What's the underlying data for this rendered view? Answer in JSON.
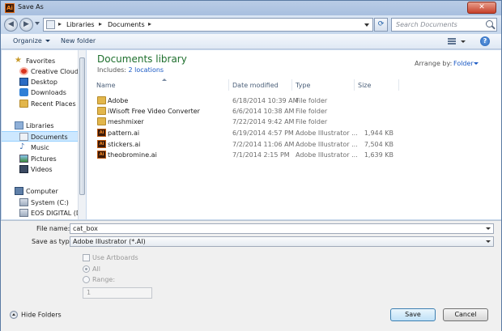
{
  "window": {
    "title": "Save As",
    "app_icon": "Ai",
    "close_label": "✕"
  },
  "address": {
    "segments": [
      "Libraries",
      "Documents"
    ],
    "search_placeholder": "Search Documents"
  },
  "toolbar": {
    "organize": "Organize",
    "new_folder": "New folder",
    "help": "?"
  },
  "nav": {
    "favorites": "Favorites",
    "creative_cloud": "Creative Cloud Fi",
    "desktop": "Desktop",
    "downloads": "Downloads",
    "recent": "Recent Places",
    "libraries": "Libraries",
    "documents": "Documents",
    "music": "Music",
    "pictures": "Pictures",
    "videos": "Videos",
    "computer": "Computer",
    "system": "System (C:)",
    "eos": "EOS DIGITAL (D:"
  },
  "library": {
    "title": "Documents library",
    "includes_label": "Includes:",
    "includes_link": "2 locations",
    "arrange_label": "Arrange by:",
    "arrange_value": "Folder"
  },
  "columns": {
    "name": "Name",
    "date": "Date modified",
    "type": "Type",
    "size": "Size"
  },
  "files": [
    {
      "name": "Adobe",
      "date": "6/18/2014 10:39 AM",
      "type": "File folder",
      "size": "",
      "icon": "folder-icon"
    },
    {
      "name": "iWisoft Free Video Converter",
      "date": "6/6/2014 10:38 AM",
      "type": "File folder",
      "size": "",
      "icon": "folder-icon"
    },
    {
      "name": "meshmixer",
      "date": "7/22/2014 9:42 AM",
      "type": "File folder",
      "size": "",
      "icon": "folder-icon"
    },
    {
      "name": "pattern.ai",
      "date": "6/19/2014 4:57 PM",
      "type": "Adobe Illustrator ...",
      "size": "1,944 KB",
      "icon": "illustrator-file-icon"
    },
    {
      "name": "stickers.ai",
      "date": "7/2/2014 11:06 AM",
      "type": "Adobe Illustrator ...",
      "size": "7,504 KB",
      "icon": "illustrator-file-icon"
    },
    {
      "name": "theobromine.ai",
      "date": "7/1/2014 2:15 PM",
      "type": "Adobe Illustrator ...",
      "size": "1,639 KB",
      "icon": "illustrator-file-icon"
    }
  ],
  "form": {
    "file_name_label": "File name:",
    "file_name_value": "cat_box",
    "save_type_label": "Save as type:",
    "save_type_value": "Adobe Illustrator (*.AI)",
    "use_artboards": "Use Artboards",
    "all": "All",
    "range": "Range:",
    "range_value": "1"
  },
  "footer": {
    "hide_folders": "Hide Folders",
    "save": "Save",
    "cancel": "Cancel"
  }
}
